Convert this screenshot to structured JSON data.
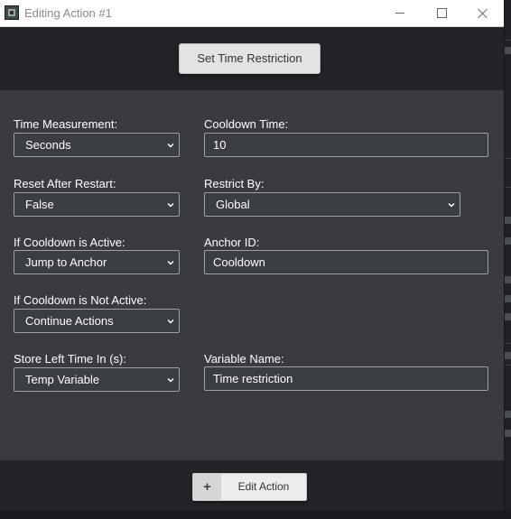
{
  "window": {
    "title": "Editing Action #1",
    "controls": {
      "minimize_icon": "minimize-icon",
      "maximize_icon": "maximize-icon",
      "close_icon": "close-icon"
    }
  },
  "header": {
    "button_label": "Set Time Restriction"
  },
  "form": {
    "time_measurement": {
      "label": "Time Measurement:",
      "value": "Seconds"
    },
    "cooldown_time": {
      "label": "Cooldown Time:",
      "value": "10"
    },
    "reset_after_restart": {
      "label": "Reset After Restart:",
      "value": "False"
    },
    "restrict_by": {
      "label": "Restrict By:",
      "value": "Global"
    },
    "if_cooldown_active": {
      "label": "If Cooldown is Active:",
      "value": "Jump to Anchor"
    },
    "anchor_id": {
      "label": "Anchor ID:",
      "value": "Cooldown"
    },
    "if_cooldown_not_active": {
      "label": "If Cooldown is Not Active:",
      "value": "Continue Actions"
    },
    "store_left_time": {
      "label": "Store Left Time In (s):",
      "value": "Temp Variable"
    },
    "variable_name": {
      "label": "Variable Name:",
      "value": "Time restriction"
    }
  },
  "footer": {
    "plus_glyph": "+",
    "edit_label": "Edit Action"
  },
  "colors": {
    "dialog_bg": "#38393c",
    "band_bg": "#232427",
    "input_bg": "#3a3d42",
    "input_border": "#9aa0a6"
  }
}
